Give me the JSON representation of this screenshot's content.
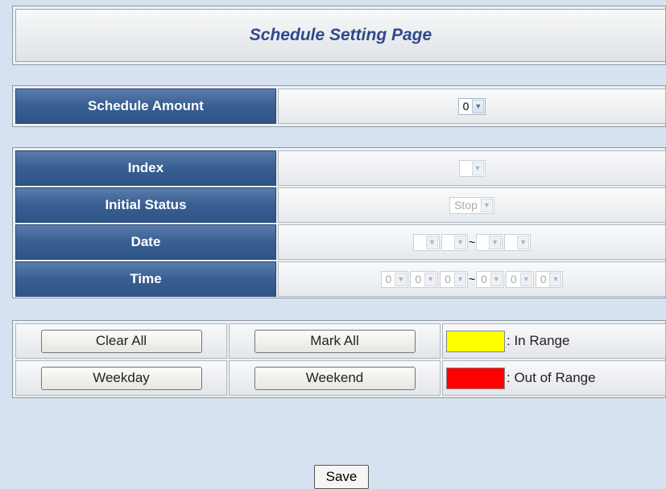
{
  "page": {
    "title": "Schedule Setting Page"
  },
  "amount": {
    "label": "Schedule Amount",
    "value": "0"
  },
  "params": {
    "index": {
      "label": "Index",
      "value": ""
    },
    "initial_status": {
      "label": "Initial Status",
      "value": "Stop"
    },
    "date": {
      "label": "Date",
      "start": [
        "",
        ""
      ],
      "end": [
        "",
        ""
      ],
      "separator": "~"
    },
    "time": {
      "label": "Time",
      "start": [
        "0",
        "0",
        "0"
      ],
      "end": [
        "0",
        "0",
        "0"
      ],
      "separator": "~"
    }
  },
  "actions": {
    "clear_all": "Clear All",
    "mark_all": "Mark All",
    "weekday": "Weekday",
    "weekend": "Weekend",
    "save": "Save"
  },
  "legend": {
    "in_range": {
      "label": ": In Range",
      "color": "#ffff00"
    },
    "out_of_range": {
      "label": ": Out of Range",
      "color": "#ff0000"
    }
  },
  "icons": {
    "dropdown": "chevron-down-icon"
  }
}
